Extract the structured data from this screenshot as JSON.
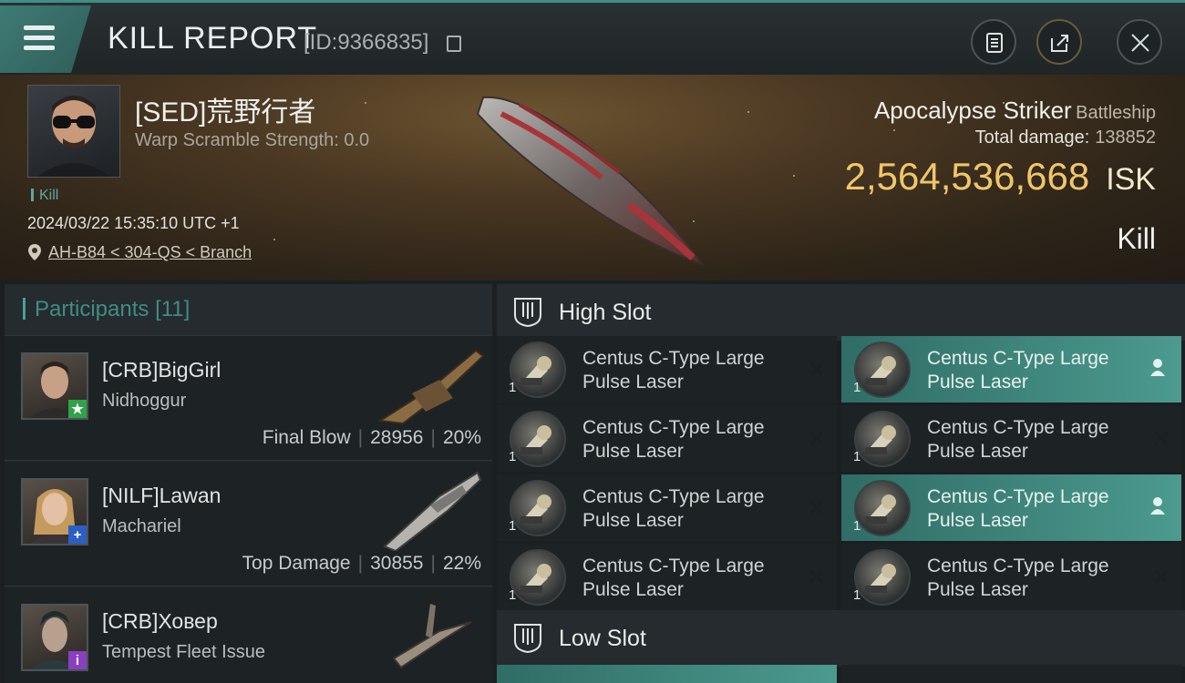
{
  "header": {
    "title": "KILL REPORT",
    "report_id": "[ID:9366835]"
  },
  "victim": {
    "name": "[SED]荒野行者",
    "warp_scramble": "Warp Scramble Strength: 0.0",
    "tag": "Kill",
    "datetime": "2024/03/22 15:35:10 UTC +1",
    "location": "AH-B84 < 304-QS < Branch",
    "ship_name": "Apocalypse Striker",
    "ship_class": "Battleship",
    "total_damage_label": "Total damage:",
    "total_damage": "138852",
    "isk_value": "2,564,536,668",
    "isk_unit": "ISK",
    "result": "Kill"
  },
  "participants": {
    "label": "Participants",
    "count": "[11]",
    "items": [
      {
        "name": "[CRB]BigGirl",
        "ship": "Nidhoggur",
        "role": "Final Blow",
        "damage": "28956",
        "percent": "20%",
        "badge": "★",
        "badge_color": "#2fa24a"
      },
      {
        "name": "[NILF]Lawan",
        "ship": "Machariel",
        "role": "Top Damage",
        "damage": "30855",
        "percent": "22%",
        "badge": "+",
        "badge_color": "#2b5fc4"
      },
      {
        "name": "[CRB]Ховер",
        "ship": "Tempest Fleet Issue",
        "badge": "i",
        "badge_color": "#8b3fc0"
      }
    ]
  },
  "slots": {
    "high_label": "High Slot",
    "low_label": "Low Slot",
    "high_items": [
      {
        "line1": "Centus C-Type Large",
        "line2": "Pulse Laser",
        "qty": "1",
        "highlight": false
      },
      {
        "line1": "Centus C-Type Large",
        "line2": "Pulse Laser",
        "qty": "1",
        "highlight": true
      },
      {
        "line1": "Centus C-Type Large",
        "line2": "Pulse Laser",
        "qty": "1",
        "highlight": false
      },
      {
        "line1": "Centus C-Type Large",
        "line2": "Pulse Laser",
        "qty": "1",
        "highlight": false
      },
      {
        "line1": "Centus C-Type Large",
        "line2": "Pulse Laser",
        "qty": "1",
        "highlight": false
      },
      {
        "line1": "Centus C-Type Large",
        "line2": "Pulse Laser",
        "qty": "1",
        "highlight": true
      },
      {
        "line1": "Centus C-Type Large",
        "line2": "Pulse Laser",
        "qty": "1",
        "highlight": false
      },
      {
        "line1": "Centus C-Type Large",
        "line2": "Pulse Laser",
        "qty": "1",
        "highlight": false
      }
    ]
  },
  "colors": {
    "accent": "#3f8d85",
    "isk": "#f0c66a",
    "highlight": "#4c9a8f"
  },
  "icons": [
    "menu-icon",
    "clipboard-icon",
    "share-icon",
    "close-icon",
    "location-pin-icon",
    "slot-icon",
    "pilot-icon",
    "remove-icon",
    "copy-icon"
  ]
}
